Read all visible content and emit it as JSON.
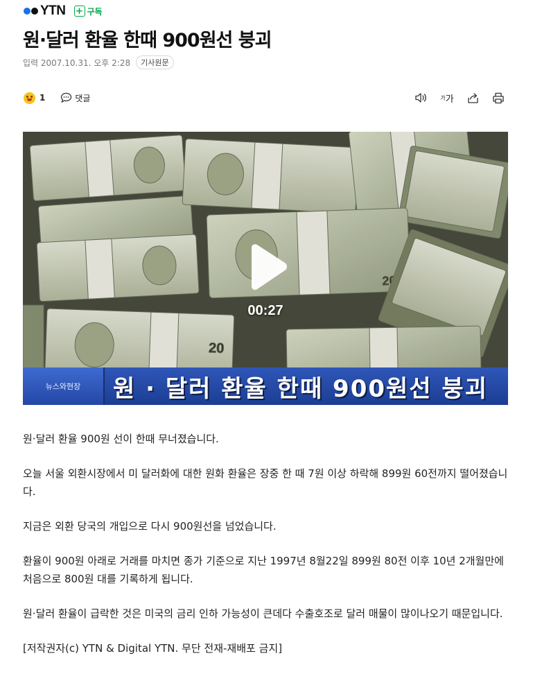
{
  "press": {
    "logo_text": "YTN",
    "subscribe_label": "구독",
    "brand_colors": {
      "dot_blue": "#1a73e8",
      "dot_black": "#111111",
      "subscribe_green": "#03a94d"
    }
  },
  "article": {
    "title": "원·달러 환율 한때 900원선 붕괴",
    "date_label": "입력 2007.10.31. 오후 2:28",
    "original_link_label": "기사원문"
  },
  "actions": {
    "reaction_count": "1",
    "comment_label": "댓글",
    "font_size_label_small": "가",
    "font_size_label_large": "가",
    "icons": [
      "smile-emoji-icon",
      "comment-bubble-icon",
      "speaker-icon",
      "font-size-icon",
      "share-icon",
      "print-icon"
    ]
  },
  "video": {
    "duration": "00:27",
    "caption_tag": "뉴스와현장",
    "caption_text": "원 · 달러 환율 한때 900원선 붕괴"
  },
  "body": {
    "paragraphs": [
      "원·달러 환율 900원 선이 한때 무너졌습니다.",
      "오늘 서울 외환시장에서 미 달러화에 대한 원화 환율은 장중 한 때 7원 이상 하락해 899원 60전까지 떨어졌습니다.",
      "지금은 외환 당국의 개입으로 다시 900원선을 넘었습니다.",
      "환율이 900원 아래로 거래를 마치면 종가 기준으로 지난 1997년 8월22일 899원 80전 이후 10년 2개월만에 처음으로 800원 대를 기록하게 됩니다.",
      "원·달러 환율이 급락한 것은 미국의 금리 인하 가능성이 큰데다 수출호조로 달러 매물이 많이나오기 때문입니다."
    ],
    "copyright": "[저작권자(c) YTN & Digital YTN. 무단 전재-재배포 금지]"
  }
}
